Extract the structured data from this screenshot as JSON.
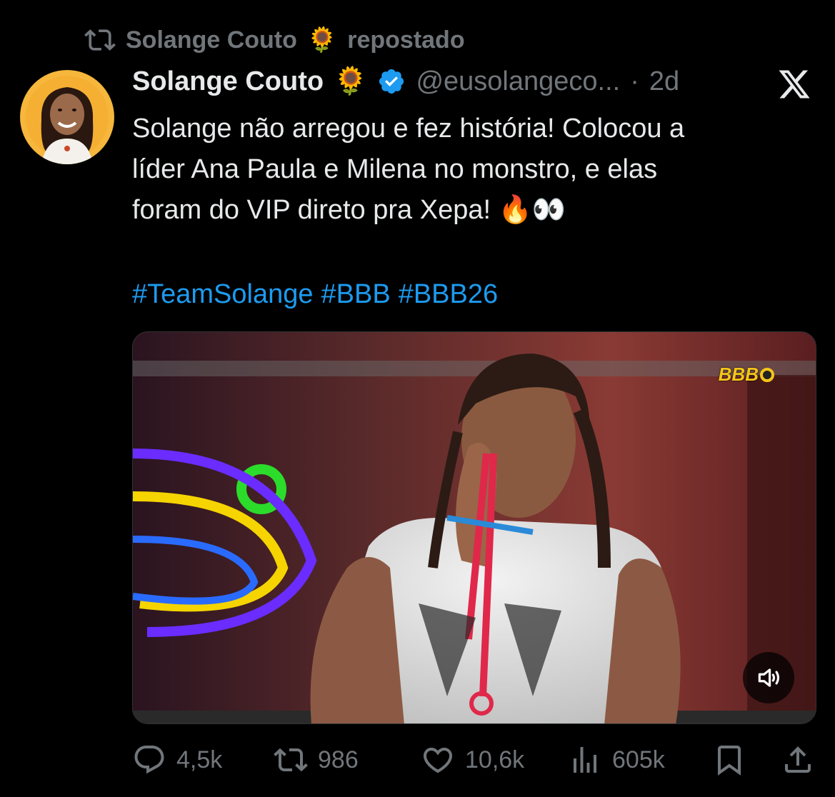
{
  "repost": {
    "name": "Solange Couto",
    "emoji": "🌻",
    "label": "repostado"
  },
  "tweet": {
    "author_name": "Solange Couto",
    "author_emoji": "🌻",
    "handle": "@eusolangeco...",
    "separator": "·",
    "time": "2d",
    "text": "Solange não arregou e fez história! Colocou a\nlíder Ana Paula e Milena no monstro, e elas\nforam do VIP direto pra Xepa!  🔥👀",
    "hashtags": [
      "#TeamSolange",
      "#BBB",
      "#BBB26"
    ]
  },
  "media": {
    "watermark": "BBB",
    "volume_icon": "speaker-muted-icon"
  },
  "actions": {
    "replies": "4,5k",
    "reposts": "986",
    "likes": "10,6k",
    "views": "605k"
  },
  "colors": {
    "background": "#000000",
    "text": "#e7e9ea",
    "muted": "#71767b",
    "link": "#1d9bf0",
    "verified": "#1d9bf0"
  }
}
